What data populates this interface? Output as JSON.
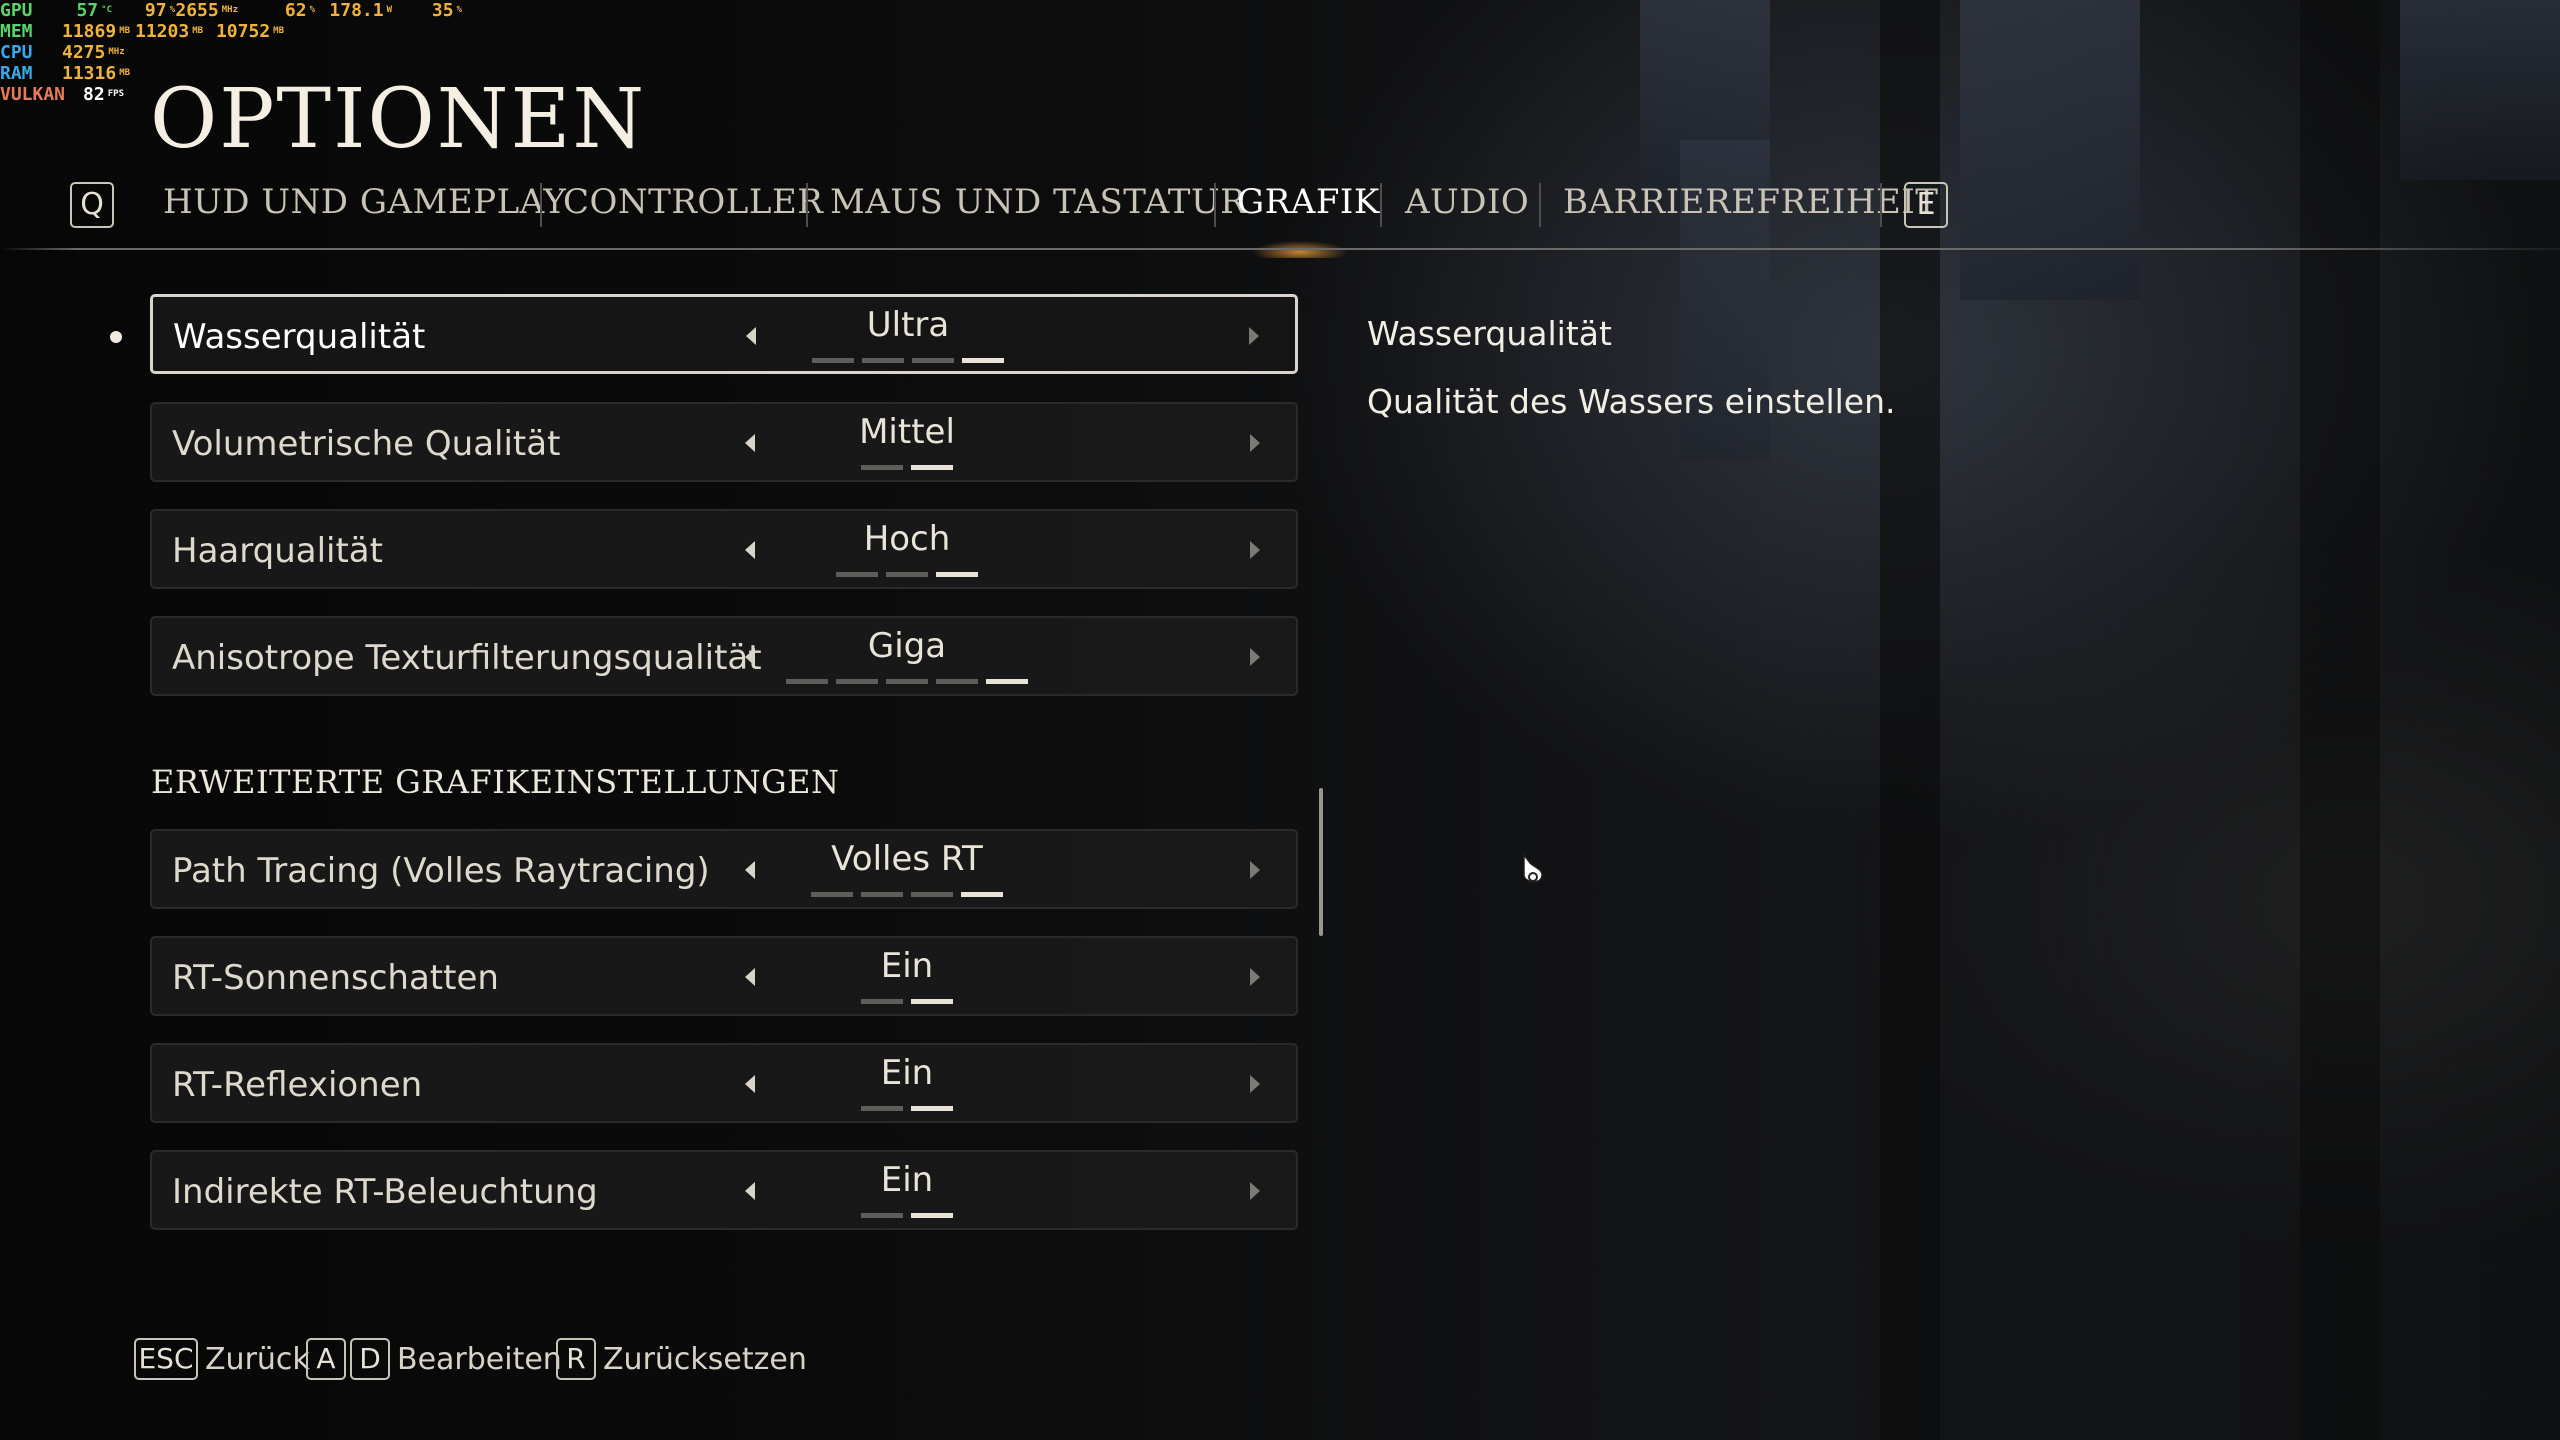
{
  "overlay": {
    "rows": [
      {
        "label": "GPU",
        "values": [
          {
            "v": "57",
            "u": "°C",
            "c": "#5bd26a"
          },
          {
            "v": "97",
            "u": "%",
            "c": "#f0b23a"
          },
          {
            "v": "2655",
            "u": "MHz",
            "c": "#f0b23a"
          },
          {
            "v": "62",
            "u": "%",
            "c": "#f0b23a"
          },
          {
            "v": "178.1",
            "u": "W",
            "c": "#f0b23a"
          },
          {
            "v": "35",
            "u": "%",
            "c": "#f0b23a"
          }
        ],
        "color": "#5bd26a"
      },
      {
        "label": "MEM",
        "values": [
          {
            "v": "11869",
            "u": "MB",
            "c": "#f0b23a"
          },
          {
            "v": "11203",
            "u": "MB",
            "c": "#f0b23a"
          },
          {
            "v": "10752",
            "u": "MB",
            "c": "#f0b23a"
          }
        ],
        "color": "#5bd26a"
      },
      {
        "label": "CPU",
        "values": [
          {
            "v": "4275",
            "u": "MHz",
            "c": "#f0b23a"
          }
        ],
        "color": "#39a8e8"
      },
      {
        "label": "RAM",
        "values": [
          {
            "v": "11316",
            "u": "MB",
            "c": "#f0b23a"
          }
        ],
        "color": "#39a8e8"
      },
      {
        "label": "VULKAN",
        "values": [
          {
            "v": "82",
            "u": "FPS",
            "c": "#ffffff"
          }
        ],
        "color": "#e87a5a"
      }
    ]
  },
  "page": {
    "title": "OPTIONEN"
  },
  "tabs": {
    "prev_key": "Q",
    "next_key": "E",
    "items": [
      {
        "label": "HUD UND GAMEPLAY",
        "active": false
      },
      {
        "label": "CONTROLLER",
        "active": false
      },
      {
        "label": "MAUS UND TASTATUR",
        "active": false
      },
      {
        "label": "GRAFIK",
        "active": true
      },
      {
        "label": "AUDIO",
        "active": false
      },
      {
        "label": "BARRIEREFREIHEIT",
        "active": false
      }
    ]
  },
  "settings": [
    {
      "label": "Wasserqualität",
      "value": "Ultra",
      "levels": 4,
      "selected_level": 4,
      "selected": true
    },
    {
      "label": "Volumetrische Qualität",
      "value": "Mittel",
      "levels": 2,
      "selected_level": 2,
      "selected": false
    },
    {
      "label": "Haarqualität",
      "value": "Hoch",
      "levels": 3,
      "selected_level": 3,
      "selected": false
    },
    {
      "label": "Anisotrope Texturfilterungsqualität",
      "value": "Giga",
      "levels": 5,
      "selected_level": 5,
      "selected": false
    }
  ],
  "advanced": {
    "heading": "ERWEITERTE GRAFIKEINSTELLUNGEN",
    "settings": [
      {
        "label": "Path Tracing (Volles Raytracing)",
        "value": "Volles RT",
        "levels": 4,
        "selected_level": 4,
        "selected": false
      },
      {
        "label": "RT-Sonnenschatten",
        "value": "Ein",
        "levels": 2,
        "selected_level": 2,
        "selected": false
      },
      {
        "label": "RT-Reflexionen",
        "value": "Ein",
        "levels": 2,
        "selected_level": 2,
        "selected": false
      },
      {
        "label": "Indirekte RT-Beleuchtung",
        "value": "Ein",
        "levels": 2,
        "selected_level": 2,
        "selected": false
      }
    ]
  },
  "description": {
    "title": "Wasserqualität",
    "text": "Qualität des Wassers einstellen."
  },
  "footer": {
    "back_key": "ESC",
    "back_label": "Zurück",
    "edit_key_left": "A",
    "edit_key_right": "D",
    "edit_label": "Bearbeiten",
    "reset_key": "R",
    "reset_label": "Zurücksetzen"
  },
  "colors": {
    "accent_glow": "#ffaa3c",
    "text": "#e6e1d6",
    "pip_on": "#e8e3d6",
    "pip_off": "#5f5d59"
  }
}
